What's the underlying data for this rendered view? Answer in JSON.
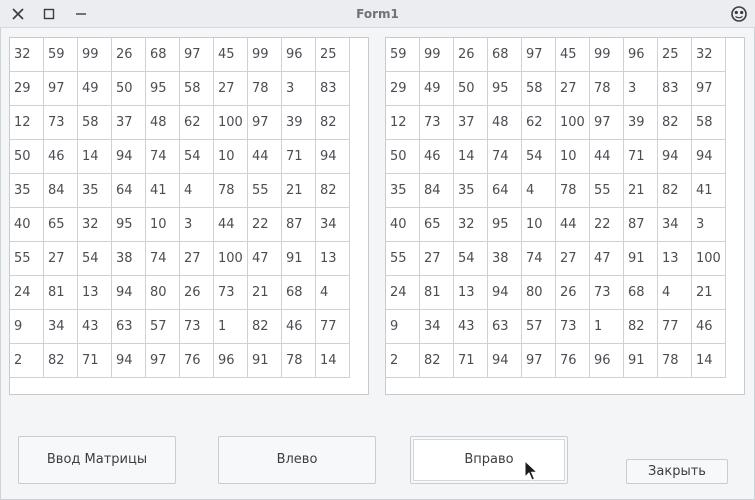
{
  "window": {
    "title": "Form1"
  },
  "left_grid": [
    [
      "32",
      "59",
      "99",
      "26",
      "68",
      "97",
      "45",
      "99",
      "96",
      "25"
    ],
    [
      "29",
      "97",
      "49",
      "50",
      "95",
      "58",
      "27",
      "78",
      "3",
      "83"
    ],
    [
      "12",
      "73",
      "58",
      "37",
      "48",
      "62",
      "100",
      "97",
      "39",
      "82"
    ],
    [
      "50",
      "46",
      "14",
      "94",
      "74",
      "54",
      "10",
      "44",
      "71",
      "94"
    ],
    [
      "35",
      "84",
      "35",
      "64",
      "41",
      "4",
      "78",
      "55",
      "21",
      "82"
    ],
    [
      "40",
      "65",
      "32",
      "95",
      "10",
      "3",
      "44",
      "22",
      "87",
      "34"
    ],
    [
      "55",
      "27",
      "54",
      "38",
      "74",
      "27",
      "100",
      "47",
      "91",
      "13"
    ],
    [
      "24",
      "81",
      "13",
      "94",
      "80",
      "26",
      "73",
      "21",
      "68",
      "4"
    ],
    [
      "9",
      "34",
      "43",
      "63",
      "57",
      "73",
      "1",
      "82",
      "46",
      "77"
    ],
    [
      "2",
      "82",
      "71",
      "94",
      "97",
      "76",
      "96",
      "91",
      "78",
      "14"
    ]
  ],
  "right_grid": [
    [
      "59",
      "99",
      "26",
      "68",
      "97",
      "45",
      "99",
      "96",
      "25",
      "32"
    ],
    [
      "29",
      "49",
      "50",
      "95",
      "58",
      "27",
      "78",
      "3",
      "83",
      "97"
    ],
    [
      "12",
      "73",
      "37",
      "48",
      "62",
      "100",
      "97",
      "39",
      "82",
      "58"
    ],
    [
      "50",
      "46",
      "14",
      "74",
      "54",
      "10",
      "44",
      "71",
      "94",
      "94"
    ],
    [
      "35",
      "84",
      "35",
      "64",
      "4",
      "78",
      "55",
      "21",
      "82",
      "41"
    ],
    [
      "40",
      "65",
      "32",
      "95",
      "10",
      "44",
      "22",
      "87",
      "34",
      "3"
    ],
    [
      "55",
      "27",
      "54",
      "38",
      "74",
      "27",
      "47",
      "91",
      "13",
      "100"
    ],
    [
      "24",
      "81",
      "13",
      "94",
      "80",
      "26",
      "73",
      "68",
      "4",
      "21"
    ],
    [
      "9",
      "34",
      "43",
      "63",
      "57",
      "73",
      "1",
      "82",
      "77",
      "46"
    ],
    [
      "2",
      "82",
      "71",
      "94",
      "97",
      "76",
      "96",
      "91",
      "78",
      "14"
    ]
  ],
  "buttons": {
    "input_matrix": "Ввод Матрицы",
    "left": "Влево",
    "right": "Вправо",
    "close": "Закрыть"
  },
  "icons": {
    "close": "close-icon",
    "maximize": "maximize-icon",
    "minimize": "minimize-icon",
    "app": "app-icon",
    "cursor": "mouse-cursor-icon"
  }
}
